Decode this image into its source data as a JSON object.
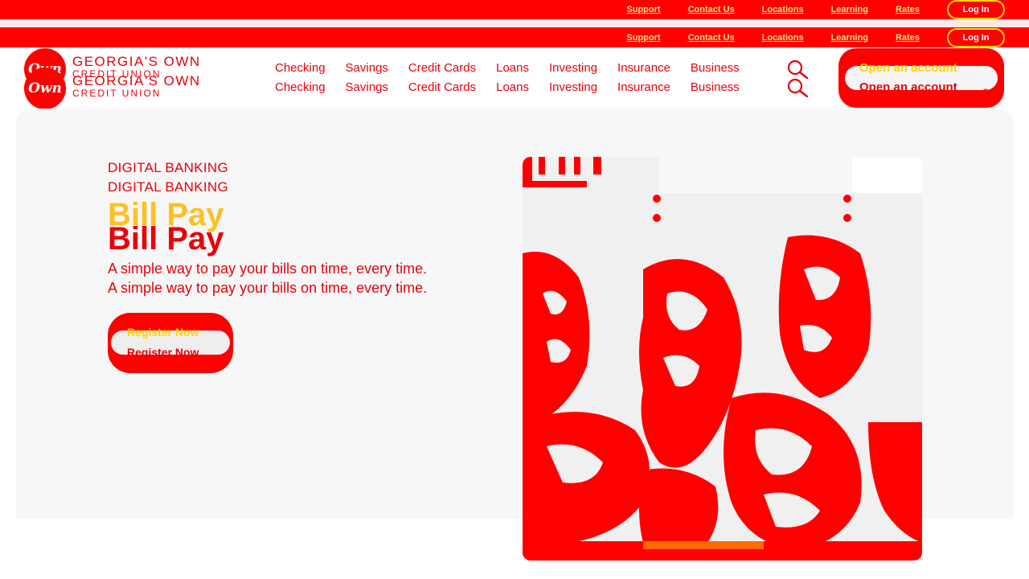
{
  "utility": {
    "links": [
      "Support",
      "Contact Us",
      "Locations",
      "Learning",
      "Rates"
    ],
    "login_label": "Log In"
  },
  "brand": {
    "mark_text": "Own",
    "name": "GEORGIA'S OWN",
    "sub": "CREDIT UNION"
  },
  "nav": {
    "items": [
      "Checking",
      "Savings",
      "Credit Cards",
      "Loans",
      "Investing",
      "Insurance",
      "Business"
    ],
    "open_account_label": "Open an account"
  },
  "hero": {
    "eyebrow": "DIGITAL BANKING",
    "title": "Bill Pay",
    "subtitle": "A simple way to pay your bills on time, every time.",
    "cta_label": "Register Now"
  },
  "colors": {
    "primary": "#ff0000",
    "text": "#e8000b",
    "accent": "#ffd400",
    "hero_bg": "#f7f7f7"
  }
}
